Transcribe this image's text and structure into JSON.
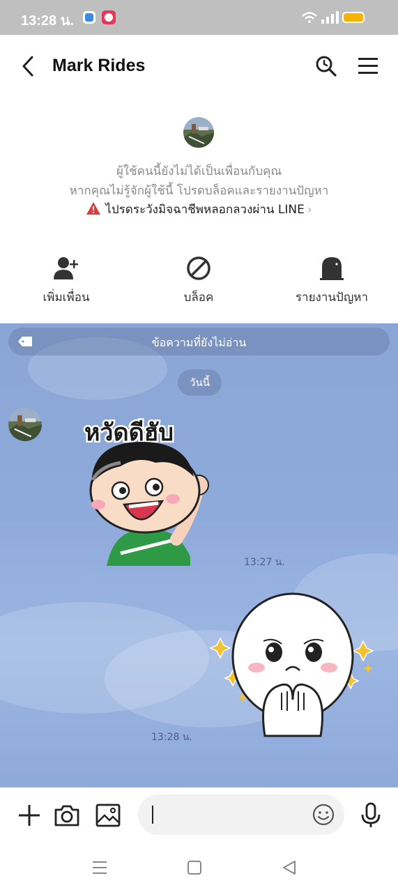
{
  "status_bar": {
    "time": "13:28 น.",
    "icons": [
      "app-icon-blue",
      "app-icon-pink",
      "wifi-icon",
      "signal-icon",
      "battery-icon"
    ]
  },
  "header": {
    "title": "Mark Rides",
    "icons": [
      "back-icon",
      "search-icon",
      "menu-icon"
    ]
  },
  "profile": {
    "notice_line1": "ผู้ใช้คนนี้ยังไม่ได้เป็นเพื่อนกับคุณ",
    "notice_line2": "หากคุณไม่รู้จักผู้ใช้นี้ โปรดบล็อคและรายงานปัญหา",
    "warning_text": "ไปรดระวังมิจฉาชีพหลอกลวงผ่าน LINE",
    "actions": [
      {
        "label": "เพิ่มเพื่อน",
        "icon": "add-friend-icon"
      },
      {
        "label": "บล็อค",
        "icon": "block-icon"
      },
      {
        "label": "รายงานปัญหา",
        "icon": "report-icon"
      }
    ]
  },
  "chat": {
    "unread_label": "ข้อความที่ยังไม่อ่าน",
    "date_label": "วันนี้",
    "messages": [
      {
        "from": "Mark Rides",
        "type": "sticker",
        "sticker_text": "หวัดดีฮับ",
        "time": "13:27 น."
      },
      {
        "from": "me",
        "type": "sticker",
        "time": "13:28 น."
      }
    ]
  },
  "input": {
    "icons": [
      "plus-icon",
      "camera-icon",
      "image-icon",
      "emoji-icon",
      "mic-icon"
    ],
    "value": ""
  },
  "nav_bar": {
    "icons": [
      "recent-apps-icon",
      "home-icon",
      "back-nav-icon"
    ]
  },
  "colors": {
    "chat_background": "#8eaadb",
    "warning_red": "#e03a3a",
    "sticker_green": "#2f9a45"
  }
}
